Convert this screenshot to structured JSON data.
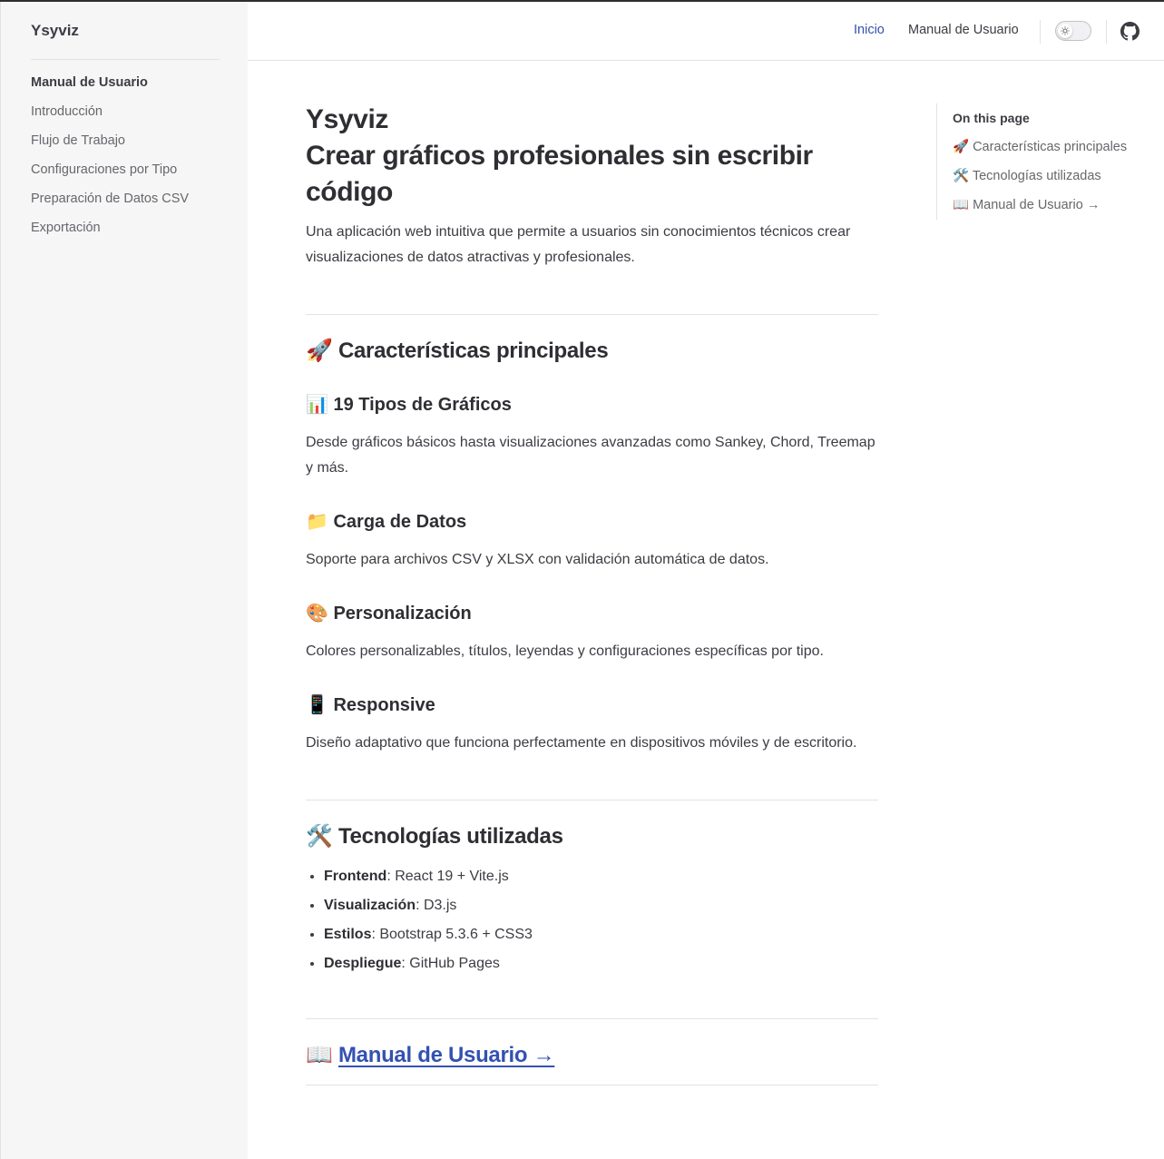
{
  "sidebar": {
    "brand": "Ysyviz",
    "section_title": "Manual de Usuario",
    "items": [
      {
        "label": "Introducción"
      },
      {
        "label": "Flujo de Trabajo"
      },
      {
        "label": "Configuraciones por Tipo"
      },
      {
        "label": "Preparación de Datos CSV"
      },
      {
        "label": "Exportación"
      }
    ]
  },
  "navbar": {
    "links": [
      {
        "label": "Inicio",
        "active": true
      },
      {
        "label": "Manual de Usuario",
        "active": false
      }
    ],
    "theme_toggle_icon": "sun-icon",
    "github_icon": "github-icon"
  },
  "main": {
    "title_line1": "Ysyviz",
    "title_line2": "Crear gráficos profesionales sin escribir código",
    "lead": "Una aplicación web intuitiva que permite a usuarios sin conocimientos técnicos crear visualizaciones de datos atractivas y profesionales.",
    "features": {
      "emoji": "🚀",
      "heading": "Características principales",
      "items": [
        {
          "emoji": "📊",
          "title": "19 Tipos de Gráficos",
          "text": "Desde gráficos básicos hasta visualizaciones avanzadas como Sankey, Chord, Treemap y más."
        },
        {
          "emoji": "📁",
          "title": "Carga de Datos",
          "text": "Soporte para archivos CSV y XLSX con validación automática de datos."
        },
        {
          "emoji": "🎨",
          "title": "Personalización",
          "text": "Colores personalizables, títulos, leyendas y configuraciones específicas por tipo."
        },
        {
          "emoji": "📱",
          "title": "Responsive",
          "text": "Diseño adaptativo que funciona perfectamente en dispositivos móviles y de escritorio."
        }
      ]
    },
    "tech": {
      "emoji": "🛠️",
      "heading": "Tecnologías utilizadas",
      "items": [
        {
          "key": "Frontend",
          "value": ": React 19 + Vite.js"
        },
        {
          "key": "Visualización",
          "value": ": D3.js"
        },
        {
          "key": "Estilos",
          "value": ": Bootstrap 5.3.6 + CSS3"
        },
        {
          "key": "Despliegue",
          "value": ": GitHub Pages"
        }
      ]
    },
    "manual_link": {
      "emoji": "📖",
      "label": "Manual de Usuario →"
    }
  },
  "aside": {
    "title": "On this page",
    "items": [
      {
        "label": "🚀 Características principales"
      },
      {
        "label": "🛠️ Tecnologías utilizadas"
      },
      {
        "label": "📖 Manual de Usuario →"
      }
    ]
  },
  "colors": {
    "accent": "#3451b2",
    "sidebar_bg": "#f6f6f7",
    "text": "#3c3c43",
    "muted": "#67676c"
  }
}
